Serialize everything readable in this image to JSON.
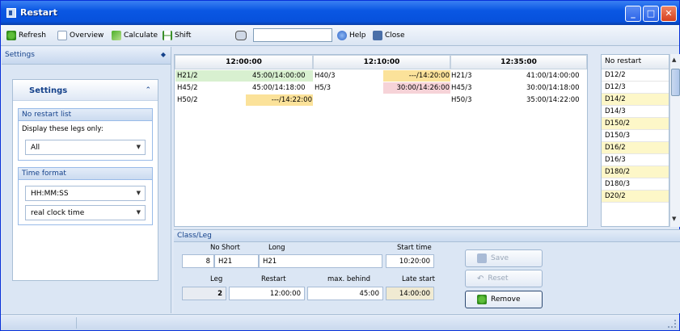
{
  "window": {
    "title": "Restart"
  },
  "toolbar": {
    "refresh": "Refresh",
    "overview": "Overview",
    "calculate": "Calculate",
    "shift": "Shift",
    "search_value": "",
    "help": "Help",
    "close": "Close"
  },
  "left_panel": {
    "header": "Settings",
    "box_title": "Settings",
    "no_restart_group": "No restart list",
    "display_label": "Display these legs only:",
    "display_value": "All",
    "time_group": "Time format",
    "time_format_value": "HH:MM:SS",
    "clock_value": "real clock time"
  },
  "grid": {
    "col_times": [
      "12:00:00",
      "12:10:00",
      "12:35:00"
    ],
    "rows": [
      {
        "c1_leg": "H21/2",
        "c1_val": "45:00/14:00:00",
        "c2_leg": "H40/3",
        "c2_val": "---/14:20:00",
        "c3_leg": "H21/3",
        "c3_val": "41:00/14:00:00"
      },
      {
        "c1_leg": "H45/2",
        "c1_val": "45:00/14:18:00",
        "c2_leg": "H5/3",
        "c2_val": "30:00/14:26:00",
        "c3_leg": "H45/3",
        "c3_val": "30:00/14:18:00"
      },
      {
        "c1_leg": "H50/2",
        "c1_val": "---/14:22:00",
        "c2_leg": "",
        "c2_val": "",
        "c3_leg": "H50/3",
        "c3_val": "35:00/14:22:00"
      }
    ]
  },
  "no_restart": {
    "header": "No restart",
    "items": [
      "D12/2",
      "D12/3",
      "D14/2",
      "D14/3",
      "D150/2",
      "D150/3",
      "D16/2",
      "D16/3",
      "D180/2",
      "D180/3",
      "D20/2"
    ]
  },
  "details": {
    "header": "Class/Leg",
    "no_label": "No",
    "short_label": "Short",
    "long_label": "Long",
    "start_time_label": "Start time",
    "no_value": "8",
    "short_value": "H21",
    "long_value": "H21",
    "start_time_value": "10:20:00",
    "leg_label": "Leg",
    "restart_label": "Restart",
    "max_behind_label": "max. behind",
    "late_start_label": "Late start",
    "leg_value": "2",
    "restart_value": "12:00:00",
    "max_behind_value": "45:00",
    "late_start_value": "14:00:00",
    "save": "Save",
    "reset": "Reset",
    "remove": "Remove"
  },
  "colors": {
    "green_cell": "#d8f0d0",
    "orange_cell": "#fbe29a",
    "pink_cell": "#f6d3d8",
    "yellow_row": "#fdf7c8",
    "title_blue": "#0a57e3"
  }
}
